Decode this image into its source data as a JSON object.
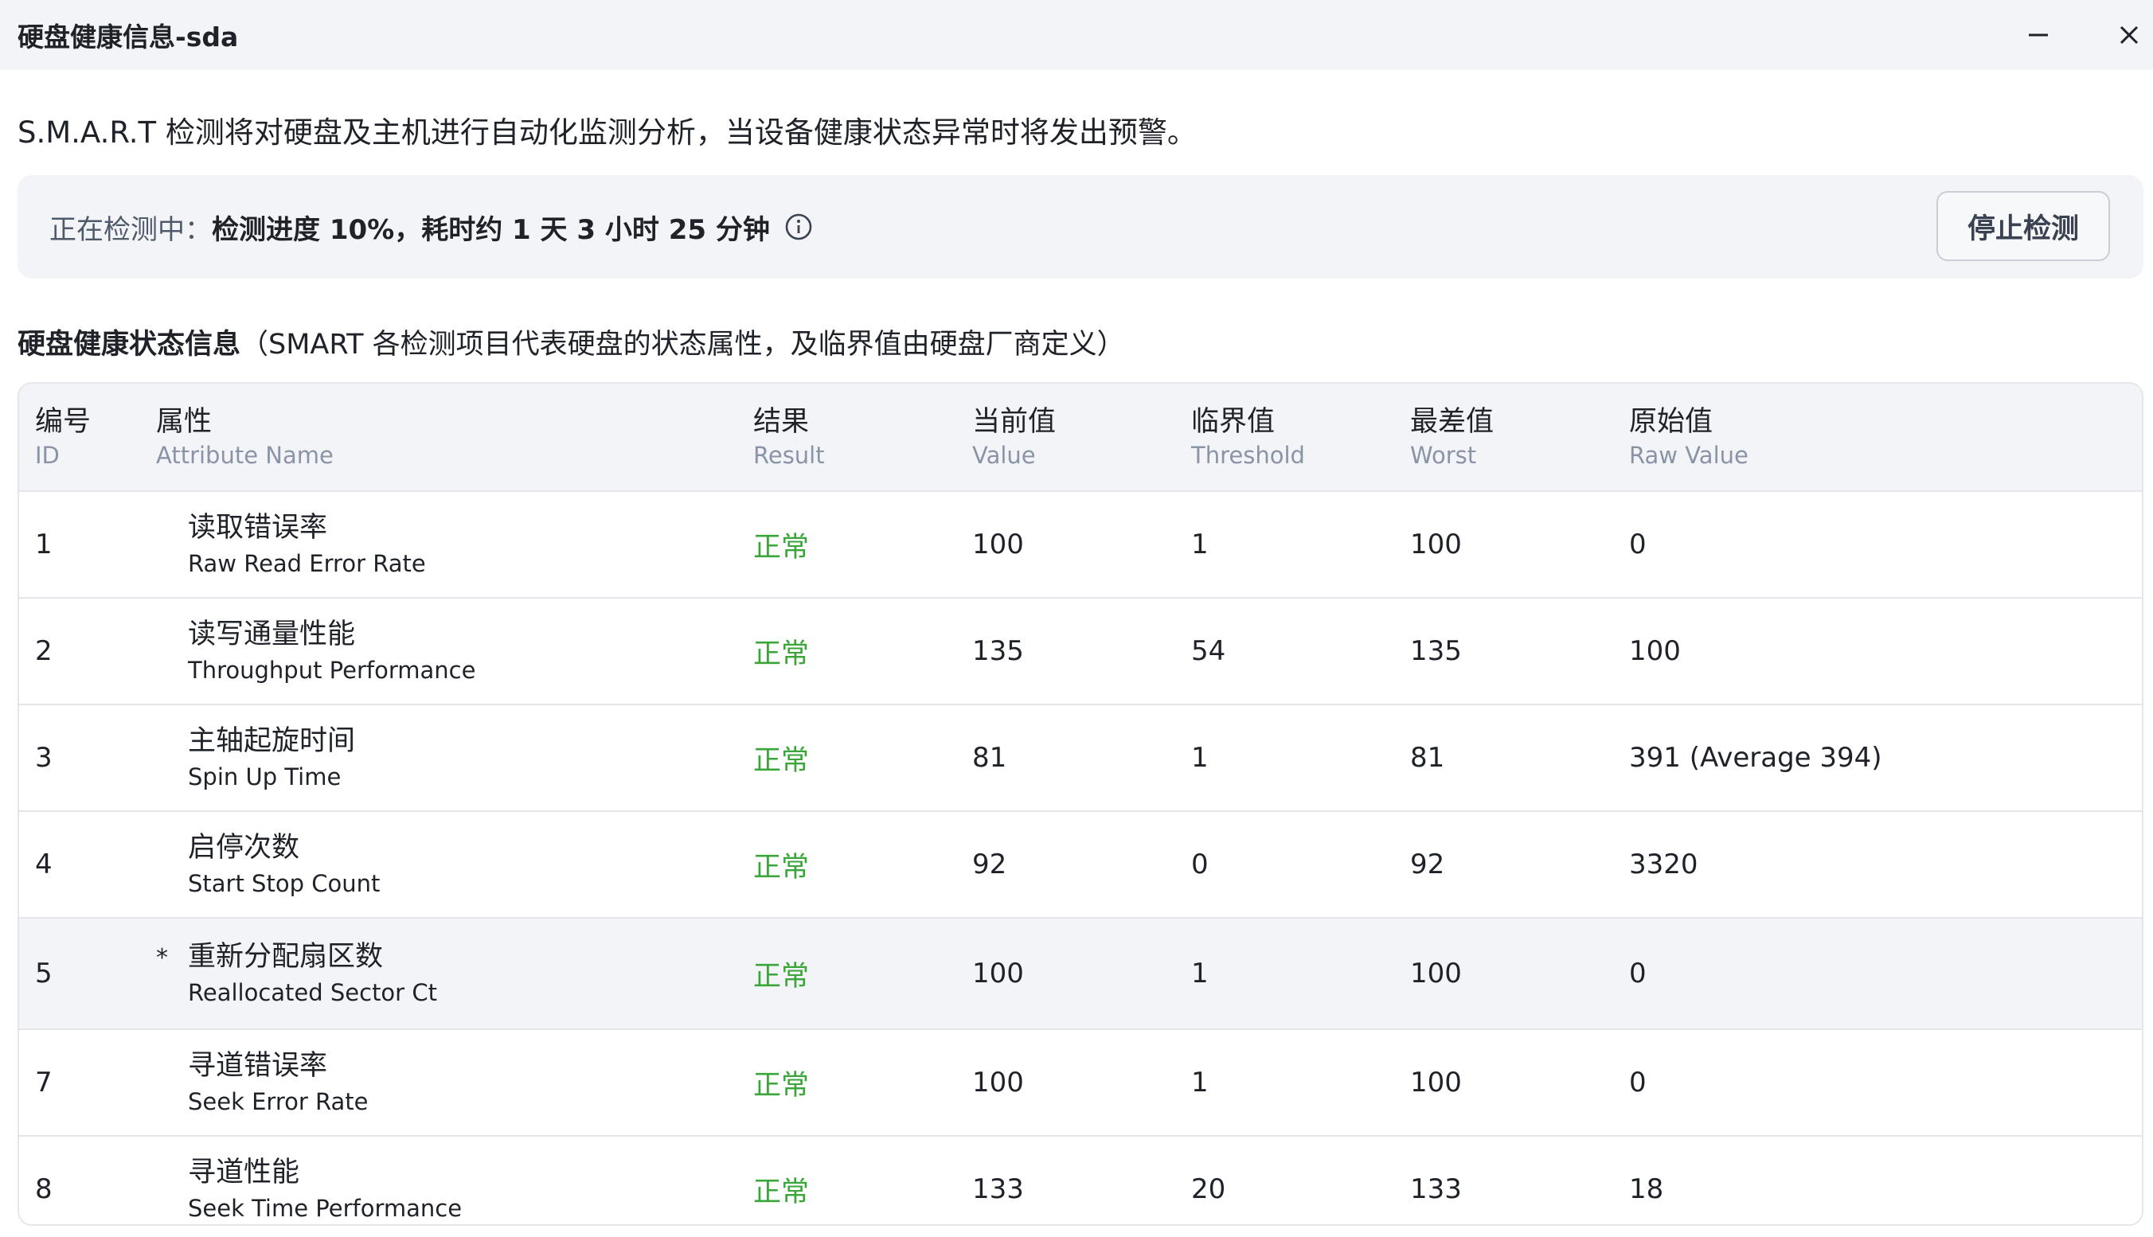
{
  "window": {
    "title": "硬盘健康信息-sda",
    "minimize_icon": "minimize-icon",
    "close_icon": "close-icon"
  },
  "description": "S.M.A.R.T 检测将对硬盘及主机进行自动化监测分析，当设备健康状态异常时将发出预警。",
  "status": {
    "label": "正在检测中：",
    "progress_text": "检测进度 10%，耗时约 1 天 3 小时 25 分钟",
    "progress_percent": 10,
    "info_icon": "info-circle-icon",
    "stop_button_label": "停止检测"
  },
  "section": {
    "heading": "硬盘健康状态信息",
    "note": "（SMART 各检测项目代表硬盘的状态属性，及临界值由硬盘厂商定义）"
  },
  "table": {
    "columns": [
      {
        "zh": "编号",
        "en": "ID"
      },
      {
        "zh": "属性",
        "en": "Attribute Name"
      },
      {
        "zh": "结果",
        "en": "Result"
      },
      {
        "zh": "当前值",
        "en": "Value"
      },
      {
        "zh": "临界值",
        "en": "Threshold"
      },
      {
        "zh": "最差值",
        "en": "Worst"
      },
      {
        "zh": "原始值",
        "en": "Raw Value"
      }
    ],
    "rows": [
      {
        "id": "1",
        "name_zh": "读取错误率",
        "name_en": "Raw Read Error Rate",
        "result": "正常",
        "value": "100",
        "threshold": "1",
        "worst": "100",
        "raw": "0",
        "star": ""
      },
      {
        "id": "2",
        "name_zh": "读写通量性能",
        "name_en": "Throughput Performance",
        "result": "正常",
        "value": "135",
        "threshold": "54",
        "worst": "135",
        "raw": "100",
        "star": ""
      },
      {
        "id": "3",
        "name_zh": "主轴起旋时间",
        "name_en": "Spin Up Time",
        "result": "正常",
        "value": "81",
        "threshold": "1",
        "worst": "81",
        "raw": "391 (Average 394)",
        "star": ""
      },
      {
        "id": "4",
        "name_zh": "启停次数",
        "name_en": "Start Stop Count",
        "result": "正常",
        "value": "92",
        "threshold": "0",
        "worst": "92",
        "raw": "3320",
        "star": ""
      },
      {
        "id": "5",
        "name_zh": "重新分配扇区数",
        "name_en": "Reallocated Sector Ct",
        "result": "正常",
        "value": "100",
        "threshold": "1",
        "worst": "100",
        "raw": "0",
        "star": "*"
      },
      {
        "id": "7",
        "name_zh": "寻道错误率",
        "name_en": "Seek Error Rate",
        "result": "正常",
        "value": "100",
        "threshold": "1",
        "worst": "100",
        "raw": "0",
        "star": ""
      },
      {
        "id": "8",
        "name_zh": "寻道性能",
        "name_en": "Seek Time Performance",
        "result": "正常",
        "value": "133",
        "threshold": "20",
        "worst": "133",
        "raw": "18",
        "star": ""
      }
    ]
  },
  "colors": {
    "ok_green": "#3aa639",
    "panel_bg": "#f2f4f7",
    "text": "#1f2329",
    "muted": "#8a94a6"
  }
}
